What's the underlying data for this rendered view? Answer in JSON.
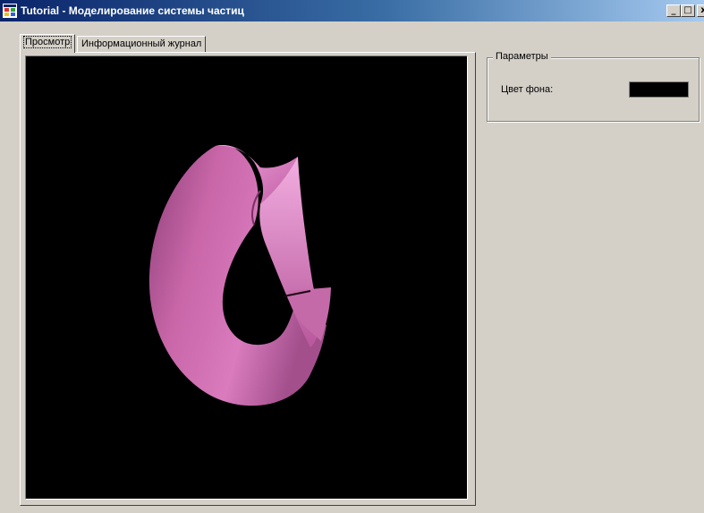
{
  "window": {
    "title": "Tutorial - Моделирование системы частиц",
    "minimize_glyph": "_",
    "maximize_glyph": "□",
    "close_glyph": "x"
  },
  "tabs": [
    {
      "label": "Просмотр",
      "active": true
    },
    {
      "label": "Информационный журнал",
      "active": false
    }
  ],
  "viewport": {
    "background": "#000000",
    "object_color": "#d673b6"
  },
  "parameters": {
    "title": "Параметры",
    "background_color_label": "Цвет фона:",
    "background_color_value": "#000000"
  }
}
